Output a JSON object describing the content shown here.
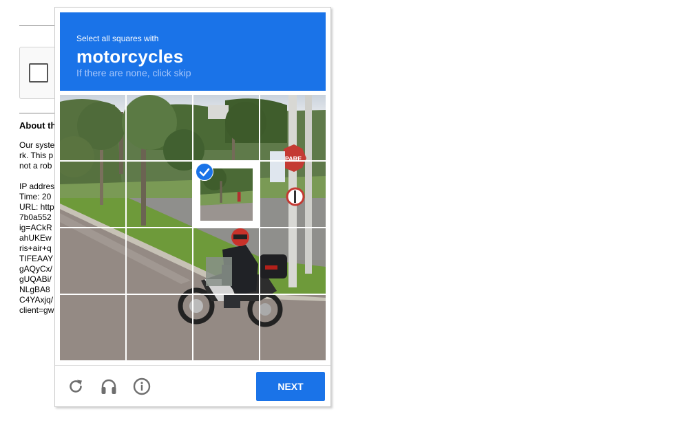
{
  "background": {
    "about_heading": "About th",
    "para1": [
      "Our syste",
      "rk. This p",
      "not a rob"
    ],
    "para2": [
      "IP addres",
      "Time: 20",
      "URL: http",
      "7b0a552",
      "ig=ACkR",
      "ahUKEw",
      "ris+air+q",
      "TIFEAAY",
      "gAQyCx/",
      "gUQABi/",
      "NLgBA8",
      "C4YAxjq/",
      "client=gw"
    ]
  },
  "challenge": {
    "instruction": "Select all squares with",
    "target": "motorcycles",
    "hint": "If there are none, click skip",
    "tiles": [
      {
        "row": 1,
        "col": 1,
        "selected": false
      },
      {
        "row": 1,
        "col": 2,
        "selected": false
      },
      {
        "row": 1,
        "col": 3,
        "selected": false
      },
      {
        "row": 1,
        "col": 4,
        "selected": false
      },
      {
        "row": 2,
        "col": 1,
        "selected": false
      },
      {
        "row": 2,
        "col": 2,
        "selected": false
      },
      {
        "row": 2,
        "col": 3,
        "selected": true
      },
      {
        "row": 2,
        "col": 4,
        "selected": false
      },
      {
        "row": 3,
        "col": 1,
        "selected": false
      },
      {
        "row": 3,
        "col": 2,
        "selected": false
      },
      {
        "row": 3,
        "col": 3,
        "selected": false
      },
      {
        "row": 3,
        "col": 4,
        "selected": false
      },
      {
        "row": 4,
        "col": 1,
        "selected": false
      },
      {
        "row": 4,
        "col": 2,
        "selected": false
      },
      {
        "row": 4,
        "col": 3,
        "selected": false
      },
      {
        "row": 4,
        "col": 4,
        "selected": false
      }
    ],
    "sign_text": "PARE",
    "next_label": "NEXT",
    "icons": [
      "reload-icon",
      "audio-icon",
      "info-icon"
    ],
    "accent_color": "#1a73e8"
  }
}
